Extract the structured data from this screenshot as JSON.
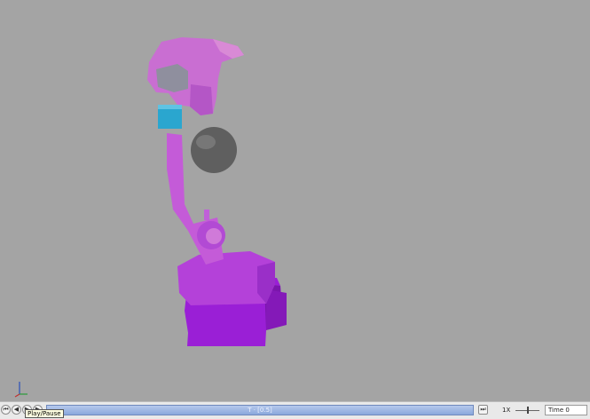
{
  "viewport": {
    "background": "#a4a4a4",
    "robot_colors": {
      "base": "#9a1fd6",
      "arm": "#c05ad6",
      "joint": "#d27fd2",
      "gripper": "#2aa6cf",
      "sphere": "#5f5f5f"
    }
  },
  "controls": {
    "buttons": [
      {
        "name": "skip-back-icon",
        "glyph": "⏮"
      },
      {
        "name": "step-back-icon",
        "glyph": "◀"
      },
      {
        "name": "play-pause-icon",
        "glyph": "▶"
      },
      {
        "name": "step-forward-icon",
        "glyph": "▶"
      }
    ],
    "tooltip": "Play/Pause",
    "timeline_label": "T · [0.5]",
    "end_button_glyph": "⏭",
    "speed_label": "1X",
    "time_label": "Time",
    "time_value": "0"
  }
}
